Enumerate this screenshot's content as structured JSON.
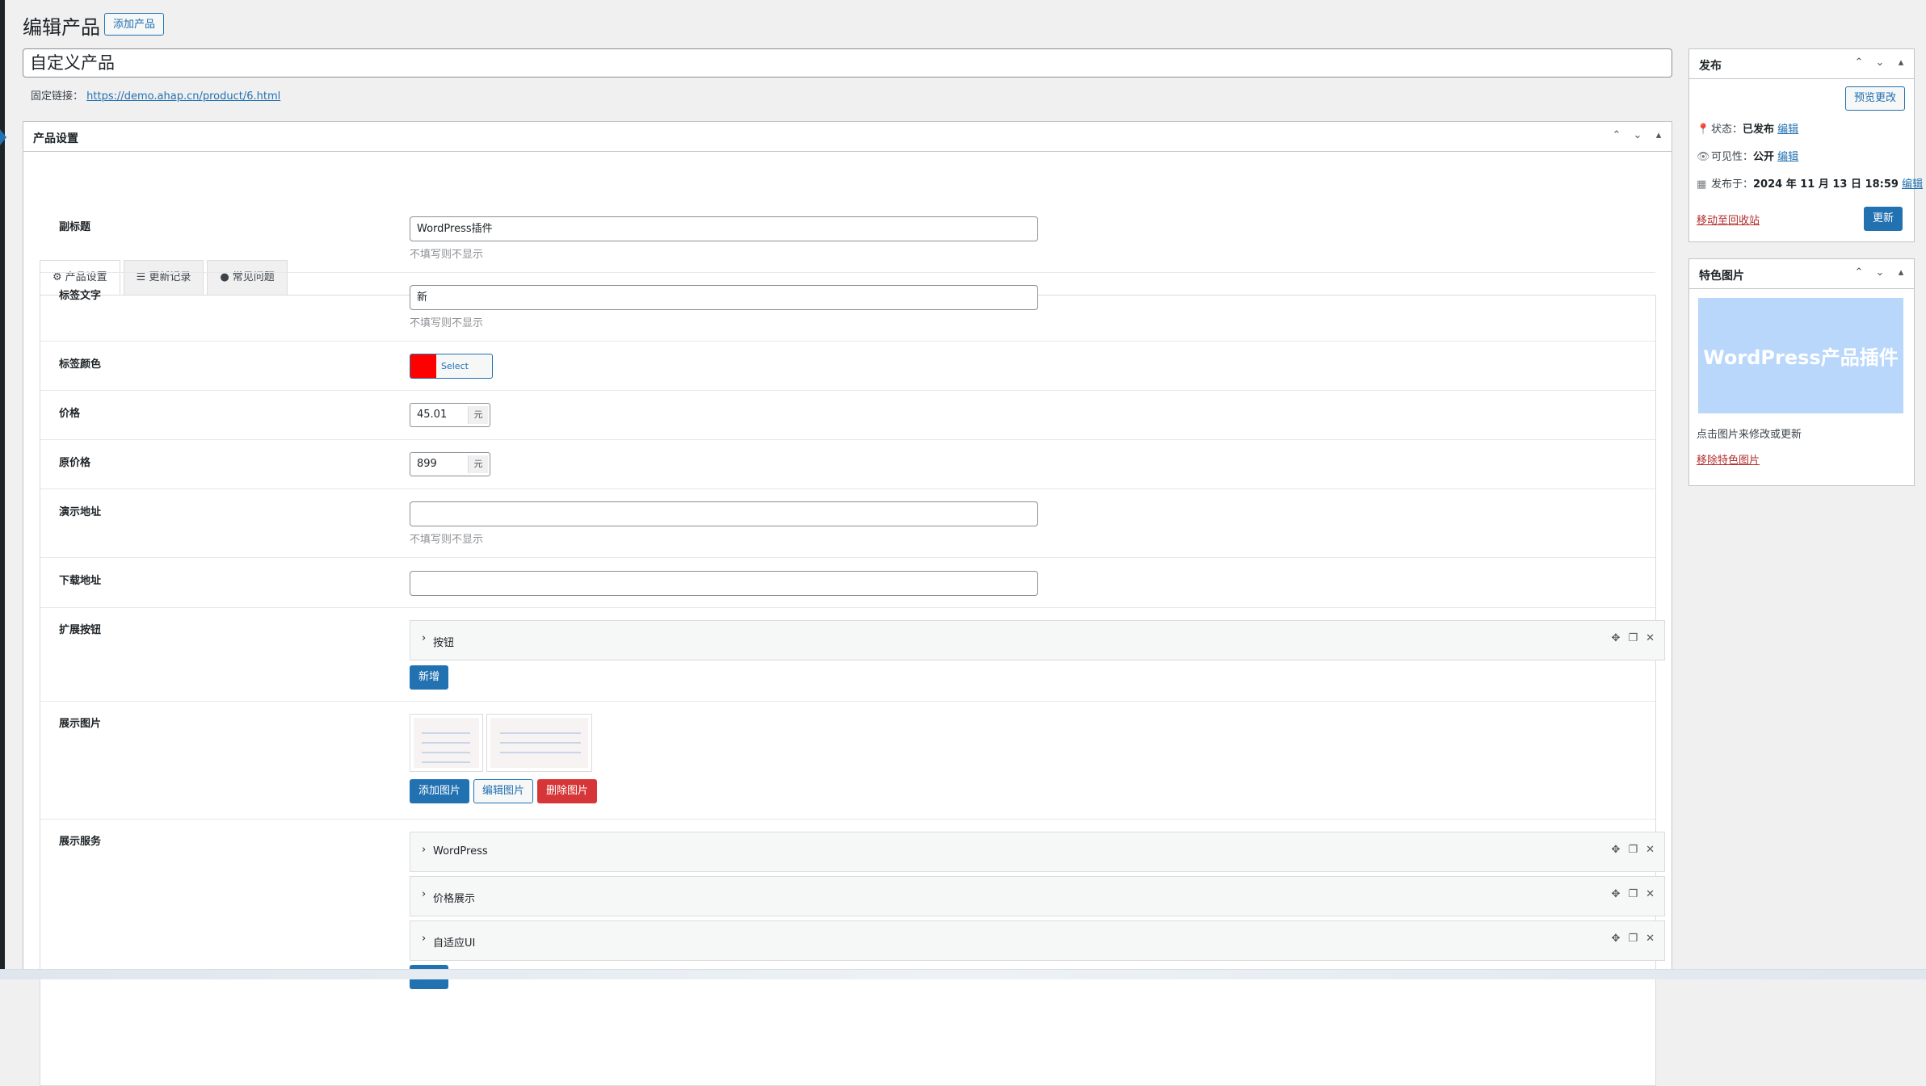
{
  "header": {
    "title": "编辑产品",
    "add_new": "添加产品"
  },
  "post_title": "自定义产品",
  "permalink": {
    "label": "固定链接：",
    "url": "https://demo.ahap.cn/product/6.html"
  },
  "settings_box": {
    "title": "产品设置",
    "tabs": [
      {
        "label": "产品设置",
        "icon": "gear-icon"
      },
      {
        "label": "更新记录",
        "icon": "list-icon"
      },
      {
        "label": "常见问题",
        "icon": "question-circle-icon"
      }
    ]
  },
  "fields": {
    "subtitle": {
      "label": "副标题",
      "value": "WordPress插件",
      "hint": "不填写则不显示"
    },
    "tag_text": {
      "label": "标签文字",
      "value": "新",
      "hint": "不填写则不显示"
    },
    "tag_color": {
      "label": "标签颜色",
      "button": "Select Color",
      "color": "#ff0000"
    },
    "price": {
      "label": "价格",
      "value": "45.01",
      "unit": "元"
    },
    "original_price": {
      "label": "原价格",
      "value": "899",
      "unit": "元"
    },
    "demo_url": {
      "label": "演示地址",
      "value": "",
      "hint": "不填写则不显示"
    },
    "download_url": {
      "label": "下载地址",
      "value": ""
    },
    "ext_buttons": {
      "label": "扩展按钮",
      "items": [
        "按钮"
      ],
      "add": "新增"
    },
    "gallery": {
      "label": "展示图片",
      "add": "添加图片",
      "edit": "编辑图片",
      "remove": "删除图片"
    },
    "services": {
      "label": "展示服务",
      "items": [
        "WordPress",
        "价格展示",
        "自适应UI"
      ]
    }
  },
  "publish_box": {
    "title": "发布",
    "preview": "预览更改",
    "status_label": "状态：",
    "status_value": "已发布",
    "visibility_label": "可见性：",
    "visibility_value": "公开",
    "published_label": "发布于：",
    "published_value": "2024 年 11 月 13 日 18:59",
    "edit": "编辑",
    "trash": "移动至回收站",
    "update": "更新"
  },
  "featured_box": {
    "title": "特色图片",
    "image_text": "WordPress产品插件",
    "hint": "点击图片来修改或更新",
    "remove": "移除特色图片"
  },
  "colors": {
    "primary": "#2271b1",
    "danger": "#d63638",
    "tag_color": "#ff0000",
    "featured_bg": "#b8d7fb"
  }
}
